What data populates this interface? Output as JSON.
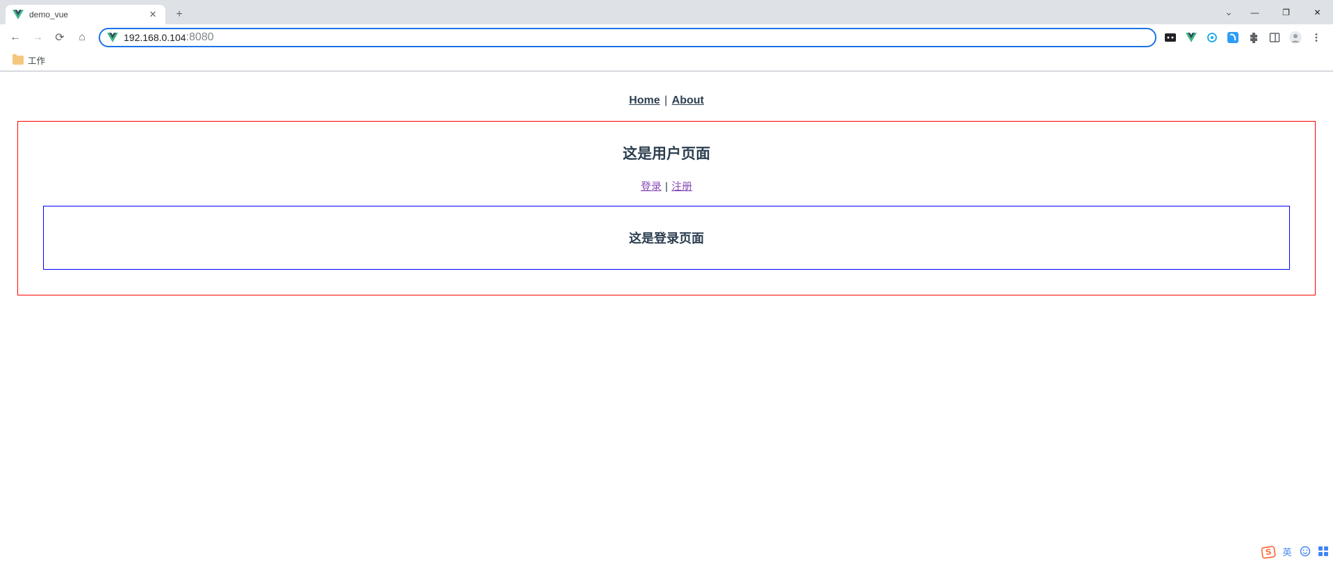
{
  "browser": {
    "tab": {
      "title": "demo_vue"
    },
    "address": {
      "host": "192.168.0.104",
      "port": ":8080"
    },
    "bookmarks": {
      "work": "工作"
    }
  },
  "nav": {
    "home": "Home",
    "about": "About",
    "sep": "|"
  },
  "user": {
    "title": "这是用户页面",
    "login": "登录",
    "register": "注册",
    "sep": "|"
  },
  "login": {
    "title": "这是登录页面"
  },
  "ime": {
    "lang": "英"
  }
}
